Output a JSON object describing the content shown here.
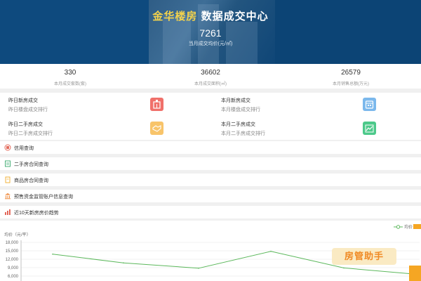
{
  "header": {
    "brand": "金华楼房",
    "title_rest": "数据成交中心",
    "price": "7261",
    "price_label": "当月成交均价(元/㎡)"
  },
  "stats": [
    {
      "value": "330",
      "label": "本月成交套数(套)"
    },
    {
      "value": "36602",
      "label": "本月成交面积(㎡)"
    },
    {
      "value": "26579",
      "label": "本月销售总额(万元)"
    }
  ],
  "quick": [
    {
      "title": "昨日新房成交",
      "subtitle": "昨日楼盘成交排行",
      "icon": "building-icon",
      "color": "#f0706a"
    },
    {
      "title": "本月新房成交",
      "subtitle": "本月楼盘成交排行",
      "icon": "calendar-icon",
      "color": "#7bb8ec"
    },
    {
      "title": "昨日二手房成交",
      "subtitle": "昨日二手房成交排行",
      "icon": "handshake-icon",
      "color": "#f8c46a"
    },
    {
      "title": "本月二手房成交",
      "subtitle": "本月二手房成交排行",
      "icon": "chart-up-icon",
      "color": "#4cc98a"
    }
  ],
  "menu": [
    {
      "label": "信用查询",
      "icon": "credit-icon",
      "color": "#e46b5c"
    },
    {
      "label": "二手房合同查询",
      "icon": "contract-icon",
      "color": "#4bb07a"
    },
    {
      "label": "商品房合同查询",
      "icon": "document-icon",
      "color": "#f2b33d"
    },
    {
      "label": "预售资金监管账户信息查询",
      "icon": "bank-icon",
      "color": "#ef8a3c"
    },
    {
      "label": "近10天新房房价趋势",
      "icon": "trend-icon",
      "color": "#e05a4b"
    }
  ],
  "chart_data": {
    "type": "line",
    "ylabel": "均价（元/平）",
    "yticks": [
      "18,000",
      "15,000",
      "12,000",
      "9,000",
      "6,000"
    ],
    "ylim": [
      6000,
      18000
    ],
    "legend": "均价",
    "series": [
      {
        "name": "均价",
        "color": "#5cb85c",
        "values": [
          13800,
          10700,
          8800,
          14800,
          8900,
          6600
        ]
      }
    ]
  },
  "watermark": "房管助手"
}
